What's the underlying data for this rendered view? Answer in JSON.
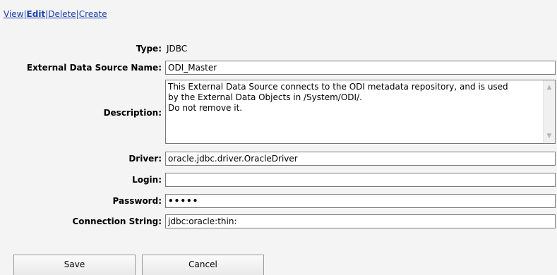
{
  "actions": {
    "view": "View",
    "edit": "Edit",
    "delete": "Delete",
    "create": "Create",
    "separator": "|"
  },
  "form": {
    "type_label": "Type:",
    "type_value": "JDBC",
    "name_label": "External Data Source Name:",
    "name_value": "ODI_Master",
    "description_label": "Description:",
    "description_lines": [
      "This External Data Source connects to the ODI metadata repository, and is used",
      "by the External Data Objects in /System/ODI/.",
      "Do not remove it."
    ],
    "driver_label": "Driver:",
    "driver_value": "oracle.jdbc.driver.OracleDriver",
    "login_label": "Login:",
    "login_value": "",
    "password_label": "Password:",
    "password_value": "•••••",
    "connection_label": "Connection String:",
    "connection_value": "jdbc:oracle:thin:"
  },
  "buttons": {
    "save": "Save",
    "cancel": "Cancel"
  },
  "icons": {
    "scroll_up": "scroll-up-arrow",
    "scroll_down": "scroll-down-arrow"
  },
  "colors": {
    "link": "#1a3fb0",
    "background": "#f4f4f4"
  }
}
